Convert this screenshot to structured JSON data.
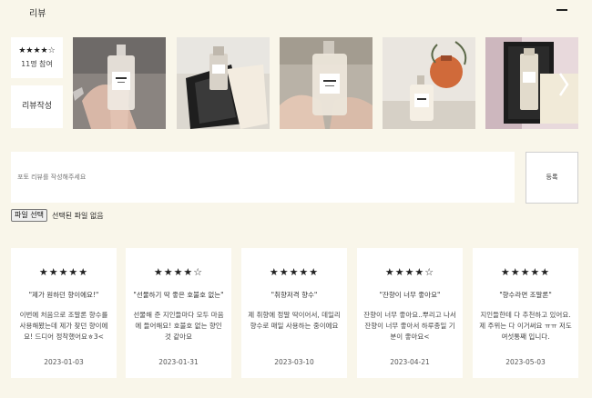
{
  "header": {
    "title": "리뷰"
  },
  "summary": {
    "stars": "★★★★☆",
    "count": "11명 참여",
    "write_label": "리뷰작성"
  },
  "photos": [
    {
      "icon": "perfume-photo-hand"
    },
    {
      "icon": "perfume-photo-box-dark"
    },
    {
      "icon": "perfume-photo-hand-bottle"
    },
    {
      "icon": "perfume-photo-vase"
    },
    {
      "icon": "perfume-photo-gift-box"
    }
  ],
  "form": {
    "placeholder": "포토 리뷰를 작성해주세요",
    "submit_label": "등록",
    "file_button": "파일 선택",
    "file_status": "선택된 파일 없음"
  },
  "reviews": [
    {
      "stars": "★★★★★",
      "title": "\"제가 원하던 향이에요!\"",
      "body": "이번에 처음으로 조말론 향수를 사용해봤는데 제가 찾던 향이에요! 드디어 정착했어요ㅎ3<",
      "date": "2023-01-03"
    },
    {
      "stars": "★★★★☆",
      "title": "\"선물하기 딱 좋은 호불호 없는\"",
      "body": "선물해 준 지인들마다 모두 마음에 들어해요! 호불호 없는 향인 것 같아요",
      "date": "2023-01-31"
    },
    {
      "stars": "★★★★★",
      "title": "\"취향저격 향수\"",
      "body": "제 취향에 정말 딱이어서, 데일리 향수로 매일 사용하는 중이에요",
      "date": "2023-03-10"
    },
    {
      "stars": "★★★★☆",
      "title": "\"잔향이 너무 좋아요\"",
      "body": "잔향이 너무 좋아요..뿌리고 나서 잔향이 너무 좋아서 하루종일 기분이 좋아요<",
      "date": "2023-04-21"
    },
    {
      "stars": "★★★★★",
      "title": "\"향수라면 조말론\"",
      "body": "지인들한테 다 추천하고 있어요. 제 주위는 다 이거써요 ㅠㅠ 저도 여섯통째 입니다.",
      "date": "2023-05-03"
    }
  ]
}
